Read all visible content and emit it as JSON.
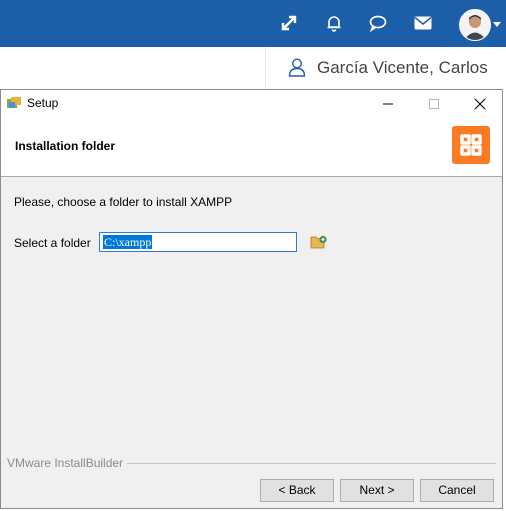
{
  "topbar": {
    "icons": [
      "expand-icon",
      "bell-icon",
      "chat-icon",
      "mail-icon"
    ],
    "brand_color": "#1d5ea8"
  },
  "user": {
    "name": "García Vicente, Carlos"
  },
  "dialog": {
    "window_title": "Setup",
    "header_title": "Installation folder",
    "prompt": "Please, choose a folder to install XAMPP",
    "folder_label": "Select a folder",
    "folder_value": "C:\\xampp",
    "footer_brand": "VMware InstallBuilder",
    "buttons": {
      "back": "< Back",
      "next": "Next >",
      "cancel": "Cancel"
    },
    "logo_color": "#fb7a24"
  }
}
